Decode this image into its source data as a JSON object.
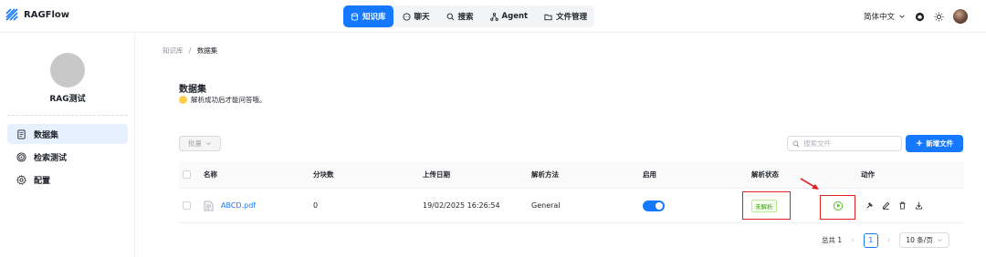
{
  "app": {
    "name": "RAGFlow"
  },
  "nav": {
    "items": [
      {
        "label": "知识库",
        "icon": "database-icon",
        "active": true
      },
      {
        "label": "聊天",
        "icon": "chat-icon",
        "active": false
      },
      {
        "label": "搜索",
        "icon": "search-icon",
        "active": false
      },
      {
        "label": "Agent",
        "icon": "agent-icon",
        "active": false
      },
      {
        "label": "文件管理",
        "icon": "folder-icon",
        "active": false
      }
    ]
  },
  "header": {
    "language": "简体中文"
  },
  "sidebar": {
    "kb_name": "RAG测试",
    "items": [
      {
        "label": "数据集",
        "icon": "document-icon",
        "active": true
      },
      {
        "label": "检索测试",
        "icon": "target-icon",
        "active": false
      },
      {
        "label": "配置",
        "icon": "gear-icon",
        "active": false
      }
    ]
  },
  "breadcrumb": {
    "root": "知识库",
    "separator": "/",
    "current": "数据集"
  },
  "page": {
    "title": "数据集",
    "subtitle": "解析成功后才能问答哦。"
  },
  "toolbar": {
    "bulk_label": "批量",
    "search_placeholder": "搜索文件",
    "add_label": "新增文件"
  },
  "table": {
    "headers": {
      "name": "名称",
      "chunks": "分块数",
      "upload_date": "上传日期",
      "parse_method": "解析方法",
      "enabled": "启用",
      "parse_status": "解析状态",
      "actions": "动作"
    },
    "rows": [
      {
        "name": "ABCD.pdf",
        "chunks": "0",
        "upload_date": "19/02/2025 16:26:54",
        "parse_method": "General",
        "enabled": true,
        "parse_status": "未解析"
      }
    ]
  },
  "pagination": {
    "total_label": "总共 1",
    "current_page": "1",
    "page_size": "10 条/页"
  },
  "colors": {
    "accent": "#1677ff",
    "highlight": "#e02020",
    "success": "#52c41a"
  }
}
